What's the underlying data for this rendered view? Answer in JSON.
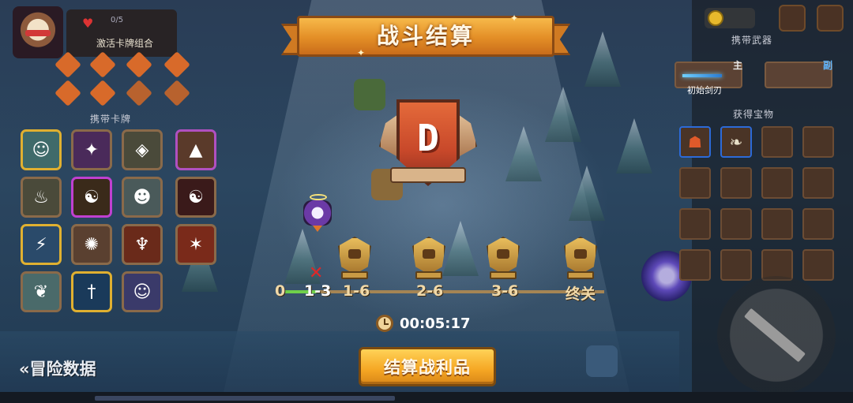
{
  "left_panel": {
    "combo_count": "0/5",
    "combo_title": "激活卡牌组合",
    "cards_title": "携带卡牌",
    "cards": [
      {
        "icon": "elder-icon",
        "glyph": "☺",
        "bg": "#3f6a6a",
        "border": "#e0b030"
      },
      {
        "icon": "rune-icon",
        "glyph": "✦",
        "bg": "#4a2a5a",
        "border": "#8a6a4a"
      },
      {
        "icon": "altar-icon",
        "glyph": "◈",
        "bg": "#4a4a3a",
        "border": "#8a6a4a"
      },
      {
        "icon": "totem-icon",
        "glyph": "▲",
        "bg": "#5a3a2a",
        "border": "#b050c0"
      },
      {
        "icon": "lantern-icon",
        "glyph": "♨",
        "bg": "#4a4a3a",
        "border": "#8a6a4a"
      },
      {
        "icon": "yinyang-icon",
        "glyph": "☯",
        "bg": "#3a2a1a",
        "border": "#c040d0"
      },
      {
        "icon": "monk-icon",
        "glyph": "☻",
        "bg": "#4a5a5a",
        "border": "#8a6a4a"
      },
      {
        "icon": "taiji-icon",
        "glyph": "☯",
        "bg": "#3a1a1a",
        "border": "#8a6a4a"
      },
      {
        "icon": "lightning-sword-icon",
        "glyph": "⚡",
        "bg": "#2a4a6a",
        "border": "#e0b030"
      },
      {
        "icon": "shell-icon",
        "glyph": "✺",
        "bg": "#5a4030",
        "border": "#8a6a4a"
      },
      {
        "icon": "dragon-icon",
        "glyph": "♆",
        "bg": "#6a2a1a",
        "border": "#8a6a4a"
      },
      {
        "icon": "fire-bird-icon",
        "glyph": "✶",
        "bg": "#7a2a1a",
        "border": "#8a6a4a"
      },
      {
        "icon": "scroll-icon",
        "glyph": "❦",
        "bg": "#4a6a6a",
        "border": "#8a6a4a"
      },
      {
        "icon": "ice-sword-icon",
        "glyph": "†",
        "bg": "#1a3a5a",
        "border": "#e0b030"
      },
      {
        "icon": "girl-icon",
        "glyph": "☺",
        "bg": "#3a3a6a",
        "border": "#8a6a4a"
      }
    ]
  },
  "banner": {
    "title": "战斗结算"
  },
  "rank": {
    "letter": "D"
  },
  "progress": {
    "fraction": 0.105,
    "stages": [
      {
        "label": "0",
        "current": false
      },
      {
        "label": "1-3",
        "current": true
      },
      {
        "label": "1-6",
        "current": false
      },
      {
        "label": "2-6",
        "current": false
      },
      {
        "label": "3-6",
        "current": false
      },
      {
        "label": "终关",
        "current": false
      }
    ],
    "death_marker": "✕"
  },
  "timer": {
    "value": "00:05:17"
  },
  "buttons": {
    "settle": "结算战利品"
  },
  "adventure_link": "«冒险数据",
  "right_panel": {
    "weapons_title": "携带武器",
    "main_tag": "主",
    "sub_tag": "副",
    "main_weapon_name": "初始剑刃",
    "relics_title": "获得宝物",
    "relics": [
      {
        "icon": "red-golem-relic-icon",
        "glyph": "☗",
        "color": "#e05a2a",
        "highlight": true
      },
      {
        "icon": "bone-wing-relic-icon",
        "glyph": "❧",
        "color": "#e8e0c8",
        "highlight": true
      },
      {
        "icon": "",
        "glyph": "",
        "color": "",
        "highlight": false
      },
      {
        "icon": "",
        "glyph": "",
        "color": "",
        "highlight": false
      },
      {
        "icon": "",
        "glyph": "",
        "color": "",
        "highlight": false
      },
      {
        "icon": "",
        "glyph": "",
        "color": "",
        "highlight": false
      },
      {
        "icon": "",
        "glyph": "",
        "color": "",
        "highlight": false
      },
      {
        "icon": "",
        "glyph": "",
        "color": "",
        "highlight": false
      },
      {
        "icon": "",
        "glyph": "",
        "color": "",
        "highlight": false
      },
      {
        "icon": "",
        "glyph": "",
        "color": "",
        "highlight": false
      },
      {
        "icon": "",
        "glyph": "",
        "color": "",
        "highlight": false
      },
      {
        "icon": "",
        "glyph": "",
        "color": "",
        "highlight": false
      },
      {
        "icon": "",
        "glyph": "",
        "color": "",
        "highlight": false
      },
      {
        "icon": "",
        "glyph": "",
        "color": "",
        "highlight": false
      },
      {
        "icon": "",
        "glyph": "",
        "color": "",
        "highlight": false
      },
      {
        "icon": "",
        "glyph": "",
        "color": "",
        "highlight": false
      }
    ]
  },
  "colors": {
    "accent_orange": "#f5a623",
    "progress_green": "#6fd04a",
    "track_brown": "#a58554",
    "death_red": "#e02828"
  }
}
